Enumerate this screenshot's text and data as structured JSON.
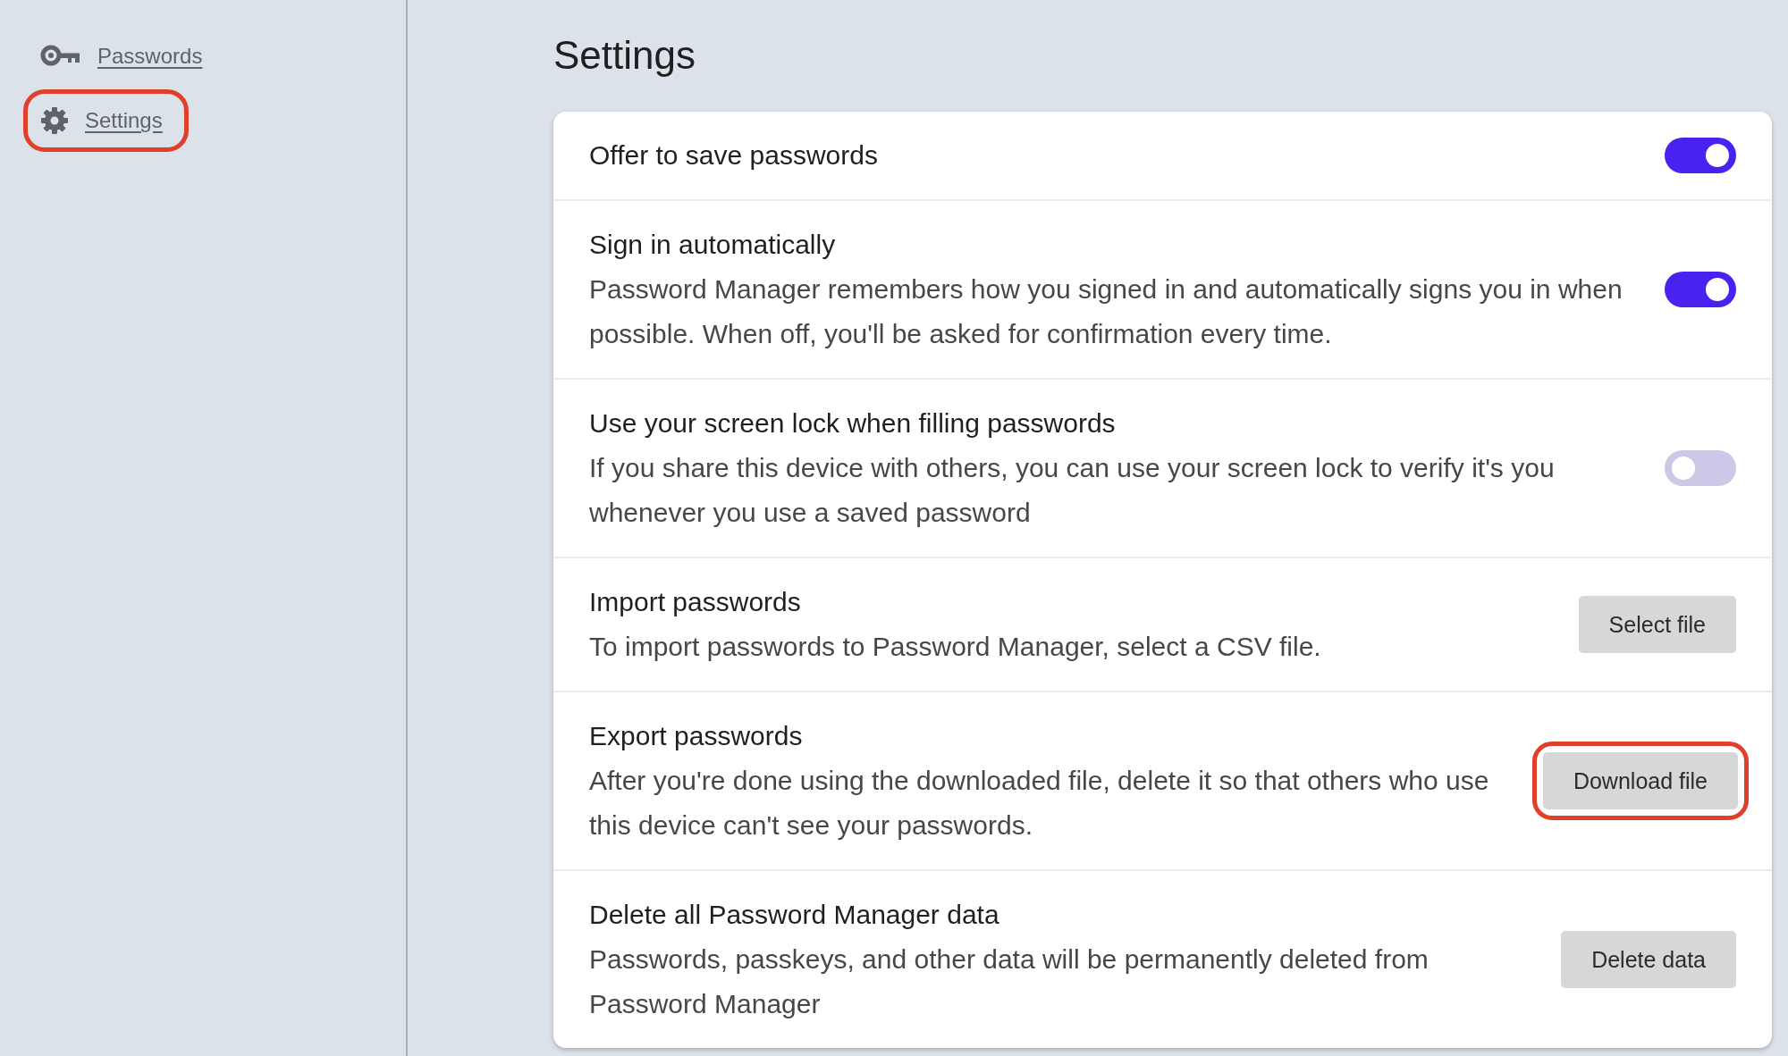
{
  "sidebar": {
    "items": [
      {
        "kind": "key",
        "label": "Passwords",
        "highlighted": false
      },
      {
        "kind": "gear",
        "label": "Settings",
        "highlighted": true
      }
    ]
  },
  "page_title": "Settings",
  "settings": [
    {
      "kind": "toggle",
      "title": "Offer to save passwords",
      "on": true
    },
    {
      "kind": "toggle",
      "title": "Sign in automatically",
      "description": "Password Manager remembers how you signed in and automatically signs you in when possible. When off, you'll be asked for confirmation every time.",
      "on": true
    },
    {
      "kind": "toggle",
      "title": "Use your screen lock when filling passwords",
      "description": "If you share this device with others, you can use your screen lock to verify it's you whenever you use a saved password",
      "on": false
    },
    {
      "kind": "button",
      "title": "Import passwords",
      "description": "To import passwords to Password Manager, select a CSV file.",
      "button": "Select file",
      "highlighted": false
    },
    {
      "kind": "button",
      "title": "Export passwords",
      "description": "After you're done using the downloaded file, delete it so that others who use this device can't see your passwords.",
      "button": "Download file",
      "highlighted": true
    },
    {
      "kind": "button",
      "title": "Delete all Password Manager data",
      "description": "Passwords, passkeys, and other data will be permanently deleted from Password Manager",
      "button": "Delete data",
      "highlighted": false
    }
  ]
}
